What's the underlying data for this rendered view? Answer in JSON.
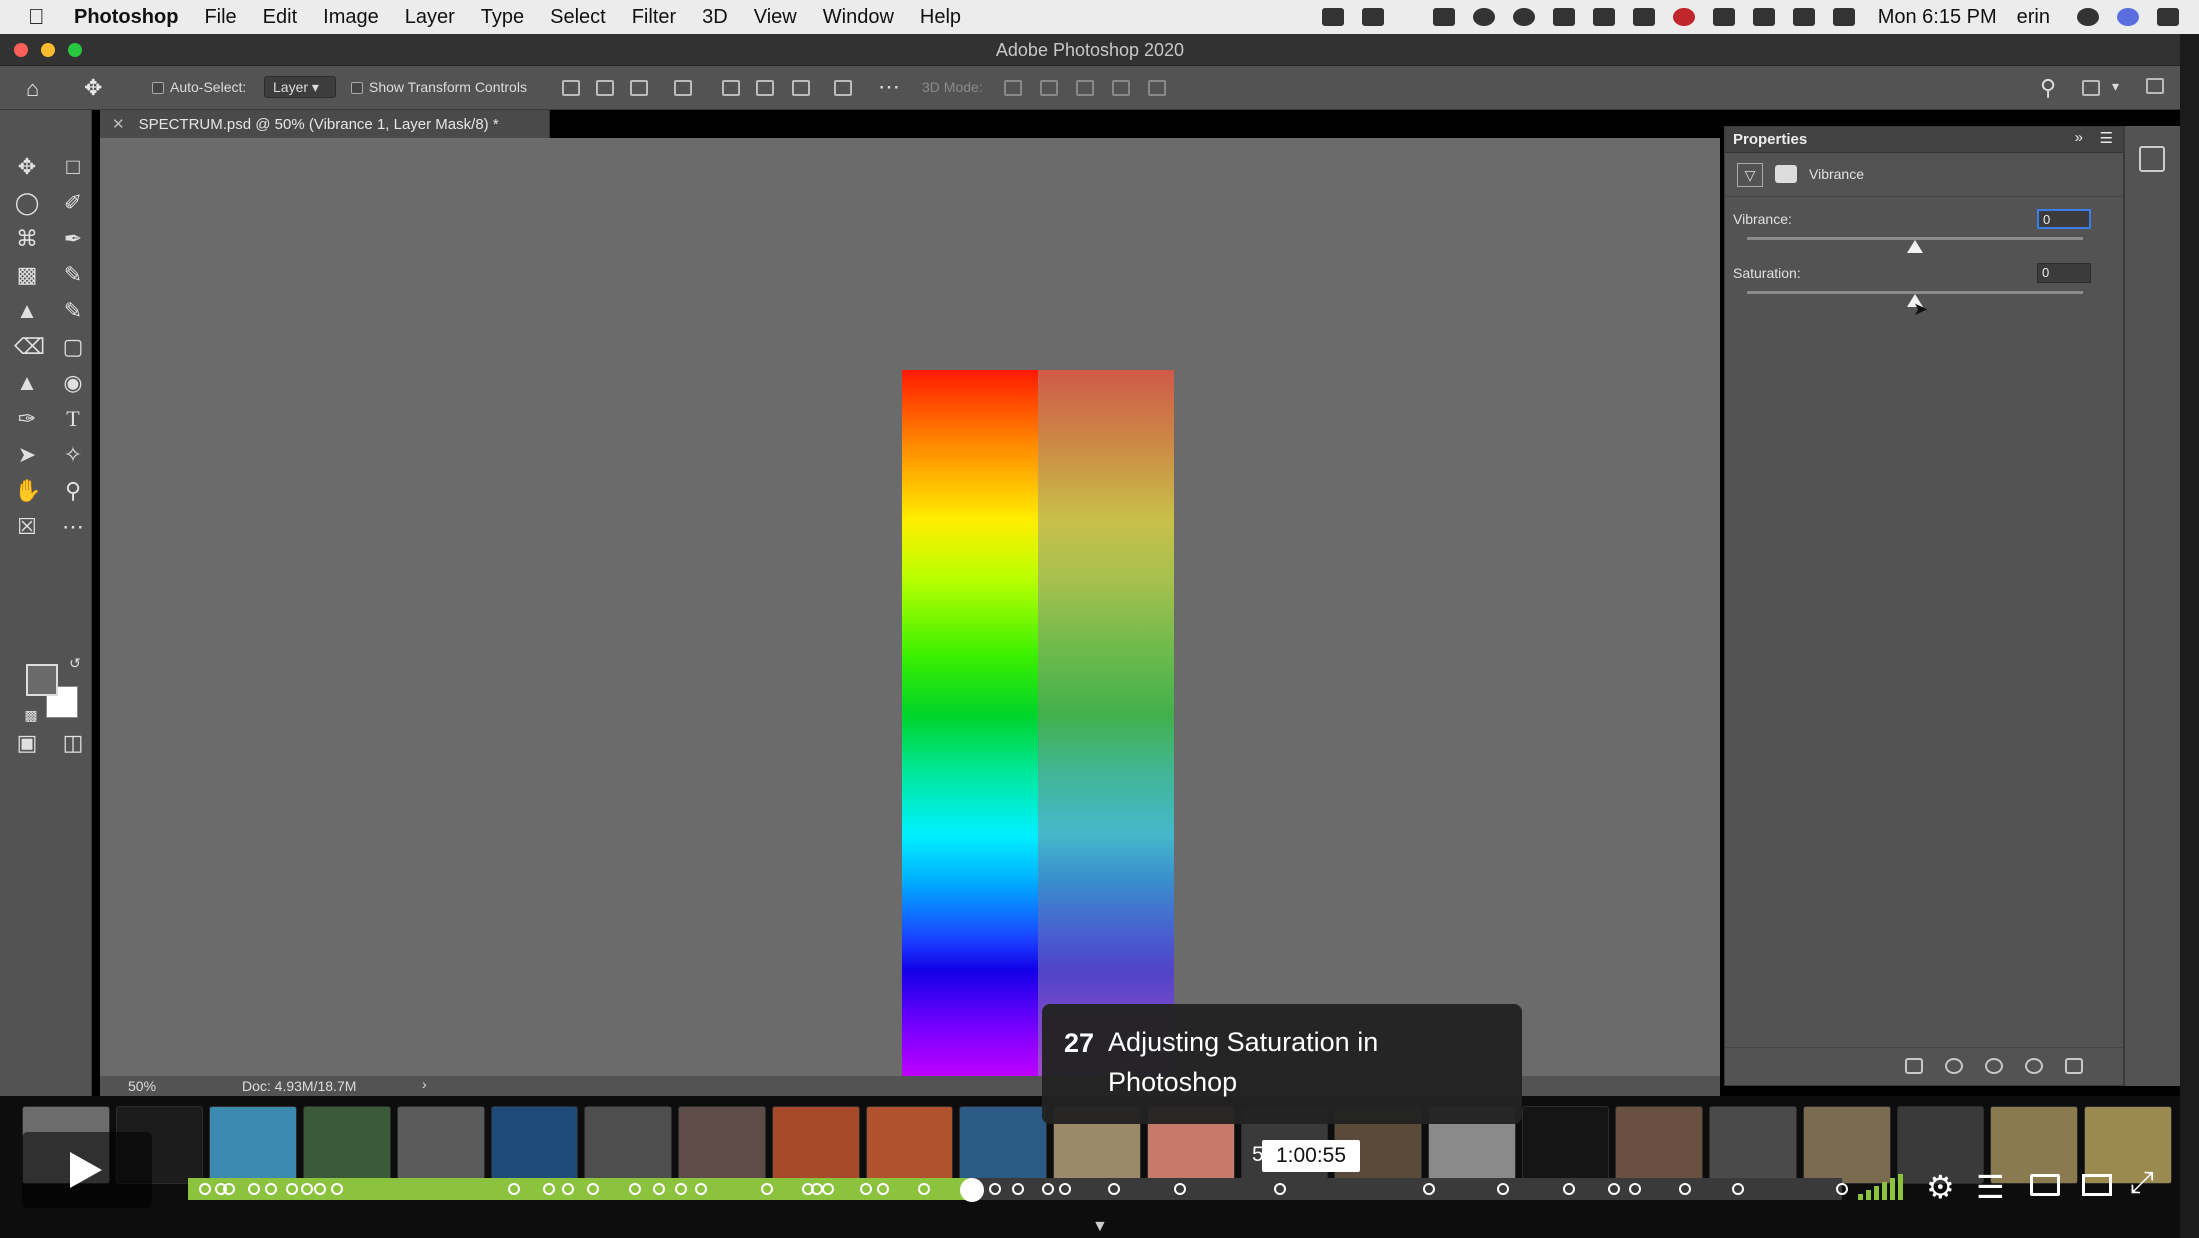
{
  "menubar": {
    "app": "Photoshop",
    "items": [
      "File",
      "Edit",
      "Image",
      "Layer",
      "Type",
      "Select",
      "Filter",
      "3D",
      "View",
      "Window",
      "Help"
    ],
    "clock": "Mon 6:15 PM",
    "user": "erin"
  },
  "window": {
    "title": "Adobe Photoshop 2020"
  },
  "options_bar": {
    "auto_select_label": "Auto-Select:",
    "auto_select_value": "Layer",
    "show_transform_label": "Show Transform Controls",
    "mode_3d_label": "3D Mode:"
  },
  "document": {
    "tab_label": "SPECTRUM.psd @ 50% (Vibrance 1, Layer Mask/8) *",
    "zoom": "50%",
    "doc_info": "Doc: 4.93M/18.7M"
  },
  "properties": {
    "title": "Properties",
    "adjustment": "Vibrance",
    "vibrance_label": "Vibrance:",
    "vibrance_value": "0",
    "saturation_label": "Saturation:",
    "saturation_value": "0",
    "vibrance_level": 0.5,
    "saturation_level": 0.5
  },
  "chapter": {
    "number": "27",
    "title": "Adjusting Saturation in Photoshop"
  },
  "player": {
    "time": "1:00:55",
    "time_prefix": "5",
    "progress": 0.474,
    "chapter_markers": [
      0.01,
      0.02,
      0.025,
      0.04,
      0.05,
      0.063,
      0.072,
      0.08,
      0.09,
      0.197,
      0.218,
      0.23,
      0.245,
      0.27,
      0.285,
      0.298,
      0.31,
      0.35,
      0.375,
      0.38,
      0.387,
      0.41,
      0.42,
      0.445,
      0.475,
      0.488,
      0.502,
      0.52,
      0.53,
      0.56,
      0.6,
      0.66,
      0.75,
      0.795,
      0.835,
      0.862,
      0.875,
      0.905,
      0.937,
      1.0
    ]
  },
  "colors": {
    "accent_green": "#8bc33e",
    "ps_panel": "#535353",
    "ps_canvas": "#6b6b6b",
    "focus_blue": "#3c7ee8"
  }
}
